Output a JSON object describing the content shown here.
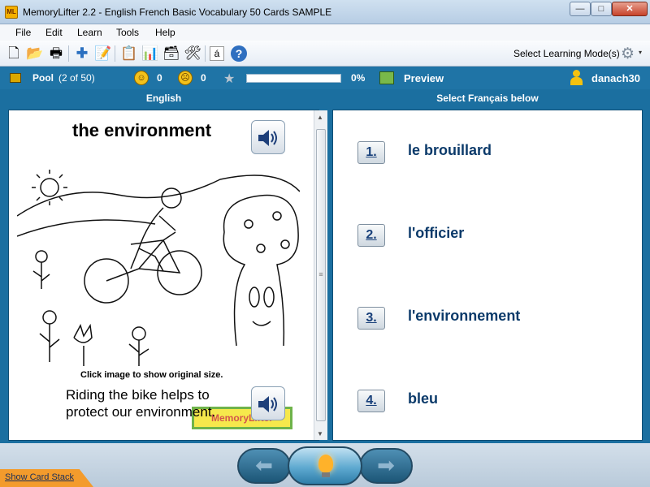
{
  "window": {
    "icon_text": "ML",
    "title": "MemoryLifter 2.2 - English French Basic Vocabulary 50 Cards SAMPLE",
    "minimize": "—",
    "maximize": "□",
    "close": "✕"
  },
  "menu": [
    "File",
    "Edit",
    "Learn",
    "Tools",
    "Help"
  ],
  "toolbar": {
    "learning_mode_label": "Select Learning Mode(s)",
    "dropdown_caret": "▾",
    "icons": [
      "new-document-icon",
      "open-folder-icon",
      "print-icon",
      "add-card-icon",
      "edit-card-icon",
      "presentation-icon",
      "statistics-icon",
      "card-box-icon",
      "settings-tools-icon",
      "special-character-icon",
      "help-icon",
      "gear-icon"
    ]
  },
  "status": {
    "pool_label": "Pool",
    "pool_count": "(2 of 50)",
    "correct_count": "0",
    "wrong_count": "0",
    "progress_percent": "0%",
    "progress_value": 0,
    "preview_label": "Preview",
    "username": "danach30"
  },
  "columns": {
    "question_header": "English",
    "answer_header": "Select Français below"
  },
  "card": {
    "word": "the environment",
    "image_caption": "Click image to show original size.",
    "example_sentence": "Riding the bike helps to protect our environment.",
    "logo_text": "MemoryLifter"
  },
  "choices": [
    {
      "number": "1.",
      "text": "le brouillard"
    },
    {
      "number": "2.",
      "text": "l'officier"
    },
    {
      "number": "3.",
      "text": "l'environnement"
    },
    {
      "number": "4.",
      "text": "bleu"
    }
  ],
  "bottom": {
    "show_card_stack": "Show Card Stack",
    "prev_arrow": "⬅",
    "next_arrow": "➡"
  },
  "colors": {
    "panel_blue": "#1b6fa0",
    "choice_text": "#0b3a6a",
    "accent_orange": "#f39b2c"
  }
}
